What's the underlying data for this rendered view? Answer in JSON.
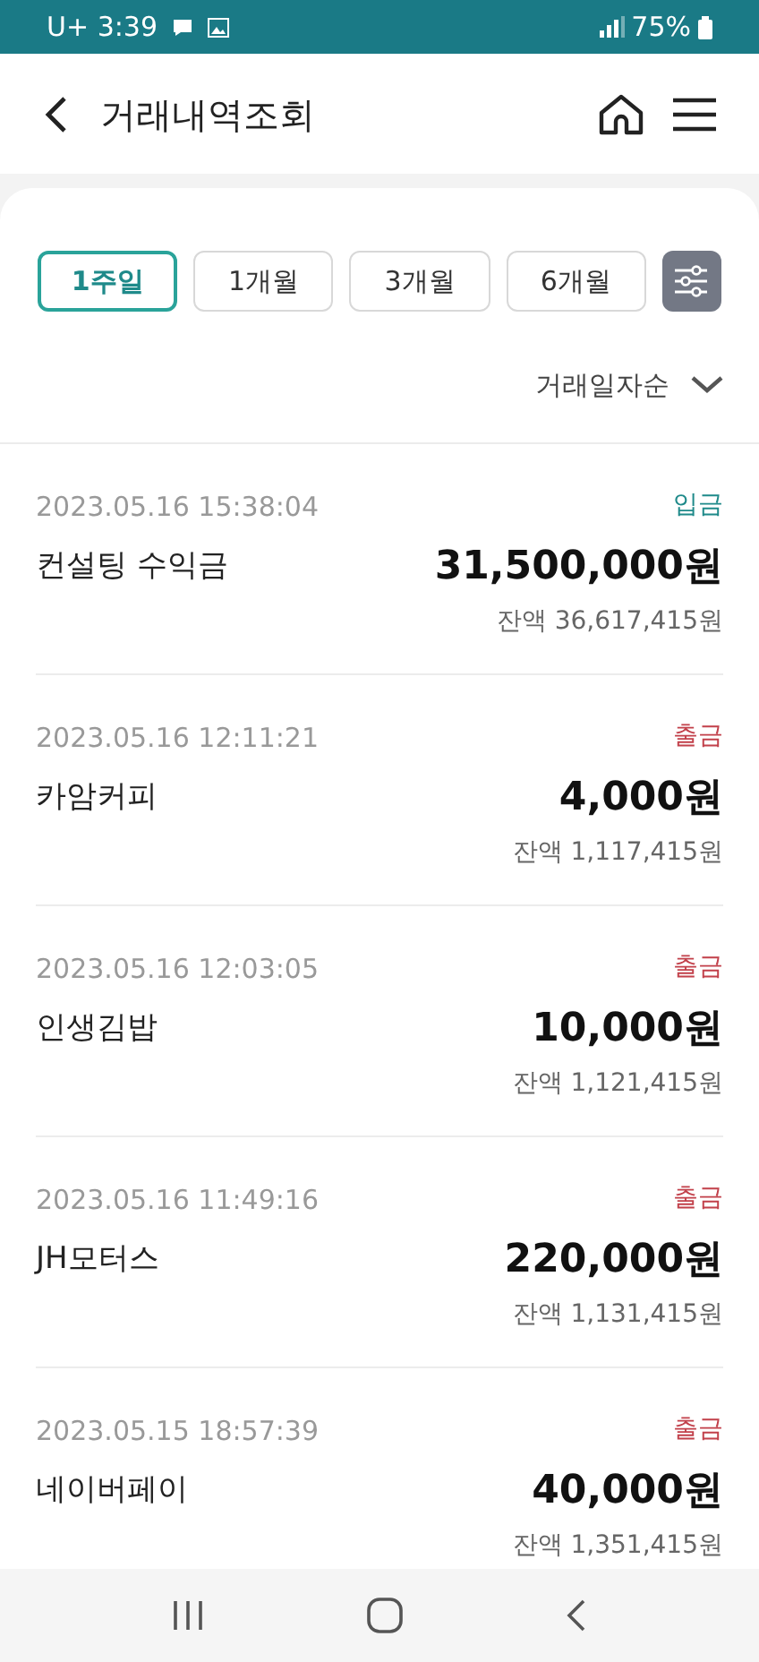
{
  "status_bar": {
    "time": "U+ 3:39",
    "battery": "75%"
  },
  "header": {
    "title": "거래내역조회"
  },
  "periods": [
    {
      "label": "1주일",
      "selected": true
    },
    {
      "label": "1개월",
      "selected": false
    },
    {
      "label": "3개월",
      "selected": false
    },
    {
      "label": "6개월",
      "selected": false
    }
  ],
  "sort": {
    "label": "거래일자순"
  },
  "transactions": [
    {
      "datetime": "2023.05.16 15:38:04",
      "kind": "deposit",
      "type_label": "입금",
      "name": "컨설팅 수익금",
      "amount": "31,500,000원",
      "balance": "잔액 36,617,415원"
    },
    {
      "datetime": "2023.05.16 12:11:21",
      "kind": "withdrawal",
      "type_label": "출금",
      "name": "카암커피",
      "amount": "4,000원",
      "balance": "잔액 1,117,415원"
    },
    {
      "datetime": "2023.05.16 12:03:05",
      "kind": "withdrawal",
      "type_label": "출금",
      "name": "인생김밥",
      "amount": "10,000원",
      "balance": "잔액 1,121,415원"
    },
    {
      "datetime": "2023.05.16 11:49:16",
      "kind": "withdrawal",
      "type_label": "출금",
      "name": "JH모터스",
      "amount": "220,000원",
      "balance": "잔액 1,131,415원"
    },
    {
      "datetime": "2023.05.15 18:57:39",
      "kind": "withdrawal",
      "type_label": "출금",
      "name": "네이버페이",
      "amount": "40,000원",
      "balance": "잔액 1,351,415원"
    }
  ]
}
